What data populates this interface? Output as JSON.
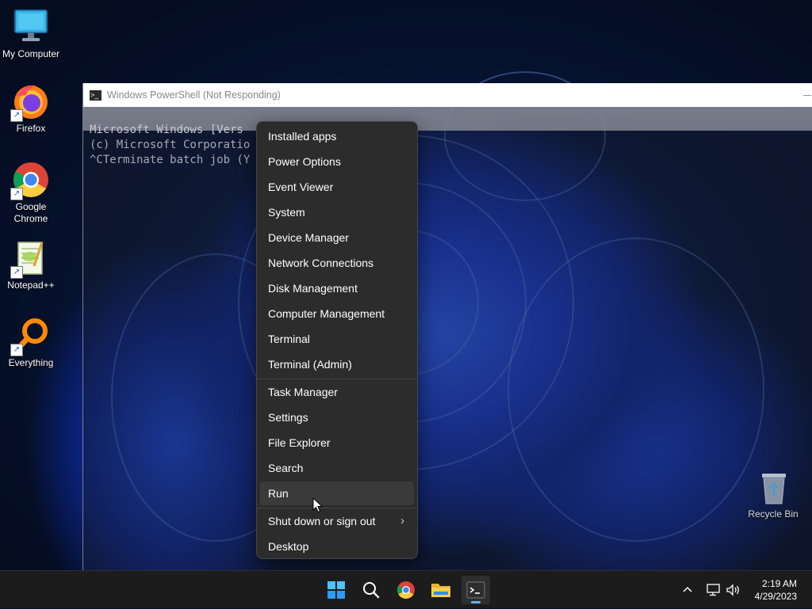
{
  "desktop": {
    "icons": [
      {
        "label": "My Computer",
        "icon": "monitor-icon"
      },
      {
        "label": "Firefox",
        "icon": "firefox-icon"
      },
      {
        "label": "Google Chrome",
        "icon": "chrome-icon"
      },
      {
        "label": "Notepad++",
        "icon": "notepadpp-icon"
      },
      {
        "label": "Everything",
        "icon": "everything-search-icon"
      }
    ],
    "recycle_bin": {
      "label": "Recycle Bin",
      "icon": "recycle-bin-icon"
    }
  },
  "powershell": {
    "title": "Windows PowerShell (Not Responding)",
    "lines": [
      "Microsoft Windows [Vers",
      "(c) Microsoft Corporatio",
      "^CTerminate batch job (Y"
    ]
  },
  "context_menu": {
    "items_group1": [
      "Installed apps",
      "Power Options",
      "Event Viewer",
      "System",
      "Device Manager",
      "Network Connections",
      "Disk Management",
      "Computer Management",
      "Terminal",
      "Terminal (Admin)"
    ],
    "items_group2": [
      "Task Manager",
      "Settings",
      "File Explorer",
      "Search",
      "Run"
    ],
    "items_group3": [
      "Shut down or sign out",
      "Desktop"
    ],
    "hovered": "Run",
    "submenu_arrow": "›"
  },
  "taskbar": {
    "apps": [
      "start-icon",
      "search-icon",
      "chrome-icon",
      "file-explorer-icon",
      "terminal-icon"
    ],
    "active_app": "terminal-icon",
    "tray": [
      "chevron-up-icon",
      "network-icon",
      "volume-icon"
    ],
    "time": "2:19 AM",
    "date": "4/29/2023"
  },
  "colors": {
    "menu_bg": "#2c2c2c",
    "taskbar_bg": "#1c1c1c",
    "accent": "#5fb0f5"
  }
}
